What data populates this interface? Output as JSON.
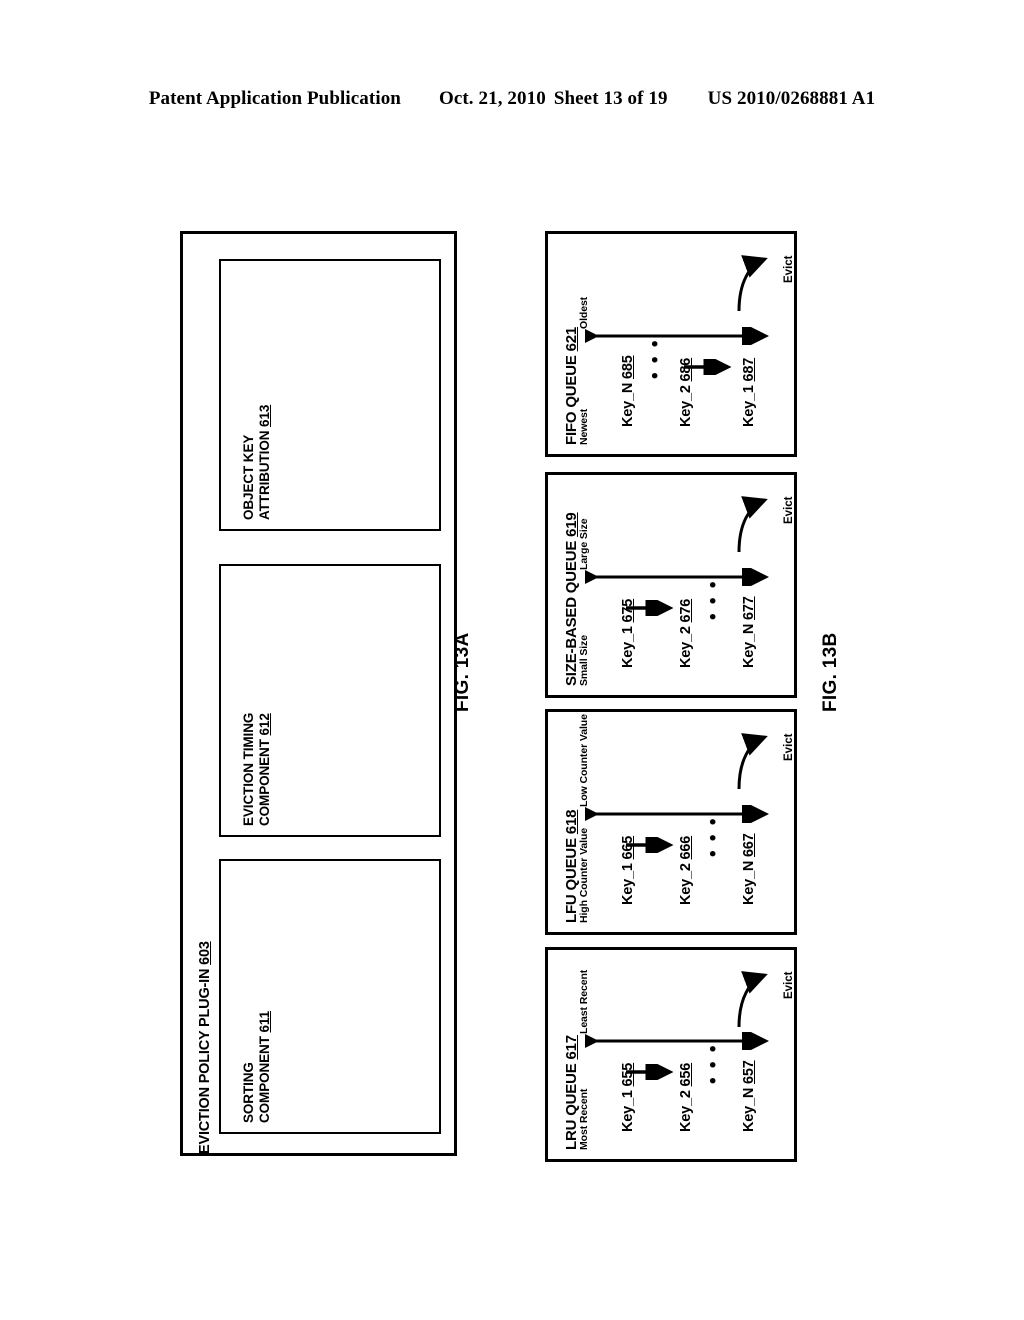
{
  "header": {
    "publication": "Patent Application Publication",
    "date": "Oct. 21, 2010",
    "sheet": "Sheet 13 of 19",
    "patent_number": "US 2010/0268881 A1"
  },
  "fig13a": {
    "caption": "FIG. 13A",
    "outer_title": "EVICTION POLICY PLUG-IN ",
    "outer_ref": "603",
    "boxes": [
      {
        "line1": "SORTING",
        "line2": "COMPONENT ",
        "ref": "611"
      },
      {
        "line1": "EVICTION TIMING",
        "line2": "COMPONENT ",
        "ref": "612"
      },
      {
        "line1": "OBJECT KEY",
        "line2": "ATTRIBUTION ",
        "ref": "613"
      }
    ]
  },
  "fig13b": {
    "caption": "FIG. 13B",
    "evict_label": "Evict",
    "dots": "• • •",
    "queues": [
      {
        "name": "FIFO QUEUE ",
        "ref": "621",
        "start_label": "Newest",
        "end_label": "Oldest",
        "keys": [
          {
            "name": "Key_N ",
            "ref": "685"
          },
          {
            "name": "Key_2 ",
            "ref": "686"
          },
          {
            "name": "Key_1 ",
            "ref": "687"
          }
        ],
        "arrow_between": [
          2,
          3
        ],
        "dots_between": [
          1,
          2
        ]
      },
      {
        "name": "SIZE-BASED QUEUE ",
        "ref": "619",
        "start_label": "Small Size",
        "end_label": "Large Size",
        "keys": [
          {
            "name": "Key_1 ",
            "ref": "675"
          },
          {
            "name": "Key_2 ",
            "ref": "676"
          },
          {
            "name": "Key_N ",
            "ref": "677"
          }
        ],
        "arrow_between": [
          1,
          2
        ],
        "dots_between": [
          2,
          3
        ]
      },
      {
        "name": "LFU QUEUE ",
        "ref": "618",
        "start_label": "High Counter Value",
        "end_label": "Low Counter Value",
        "keys": [
          {
            "name": "Key_1 ",
            "ref": "665"
          },
          {
            "name": "Key_2 ",
            "ref": "666"
          },
          {
            "name": "Key_N ",
            "ref": "667"
          }
        ],
        "arrow_between": [
          1,
          2
        ],
        "dots_between": [
          2,
          3
        ]
      },
      {
        "name": "LRU QUEUE ",
        "ref": "617",
        "start_label": "Most Recent",
        "end_label": "Least Recent",
        "keys": [
          {
            "name": "Key_1 ",
            "ref": "655"
          },
          {
            "name": "Key_2 ",
            "ref": "656"
          },
          {
            "name": "Key_N ",
            "ref": "657"
          }
        ],
        "arrow_between": [
          1,
          2
        ],
        "dots_between": [
          2,
          3
        ]
      }
    ]
  },
  "colors": {
    "ink": "#000000",
    "paper": "#ffffff"
  }
}
